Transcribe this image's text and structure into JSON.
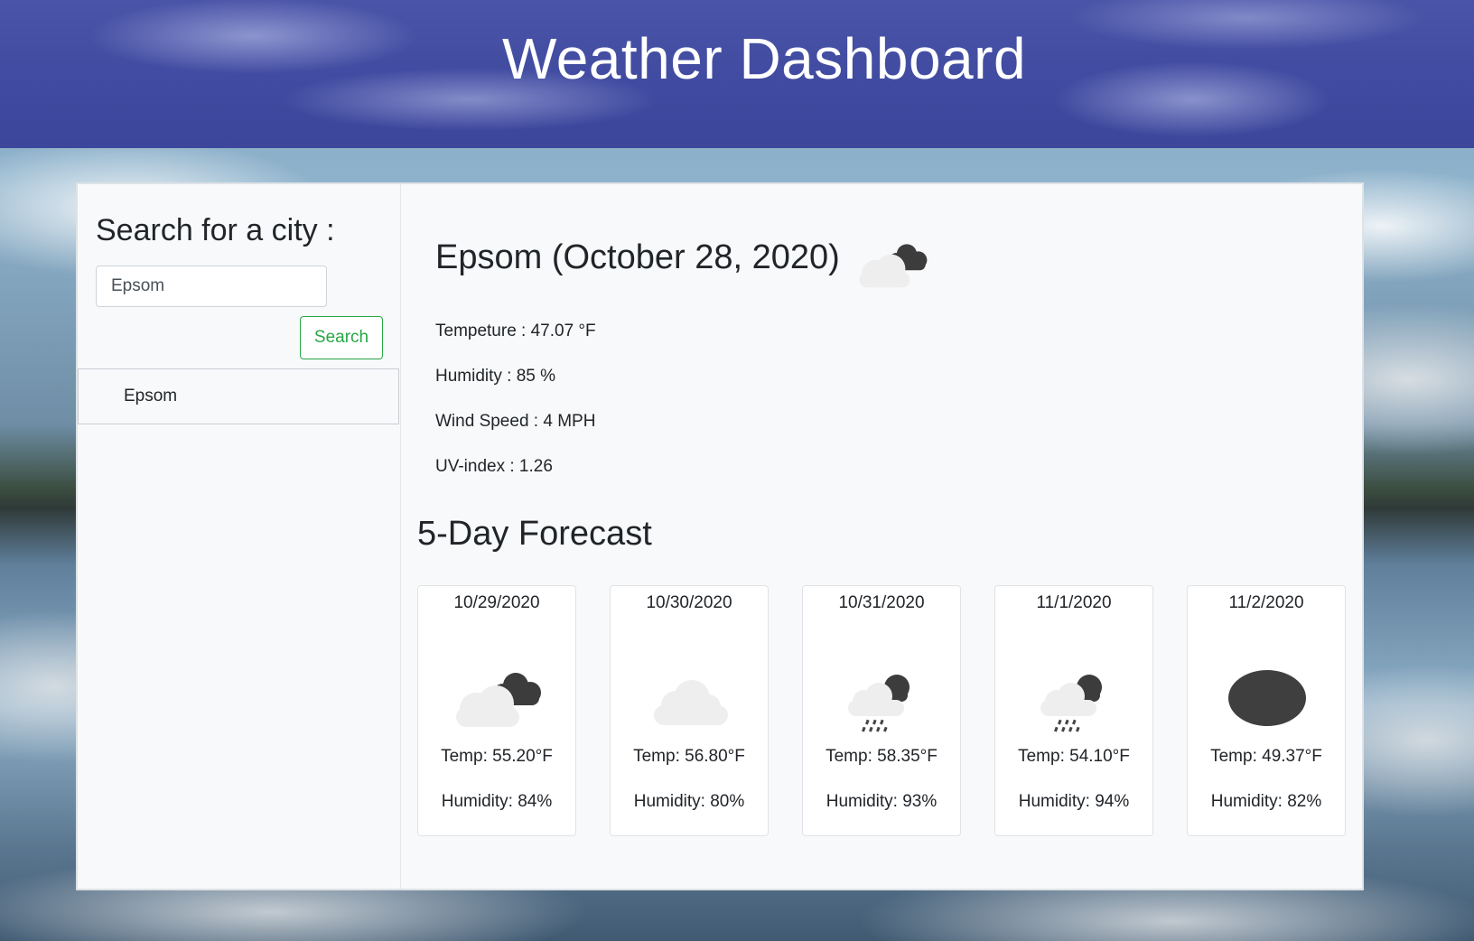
{
  "header": {
    "title": "Weather Dashboard"
  },
  "sidebar": {
    "heading": "Search for a city :",
    "search_value": "Epsom",
    "search_button": "Search",
    "history": [
      "Epsom"
    ]
  },
  "current": {
    "title": "Epsom (October 28, 2020)",
    "icon": "broken-clouds-icon",
    "temperature": "Tempeture : 47.07 °F",
    "humidity": "Humidity : 85 %",
    "wind": "Wind Speed : 4 MPH",
    "uv": "UV-index : 1.26"
  },
  "forecast": {
    "title": "5-Day Forecast",
    "days": [
      {
        "date": "10/29/2020",
        "icon": "broken-clouds-icon",
        "temp": "Temp: 55.20°F",
        "humidity": "Humidity: 84%"
      },
      {
        "date": "10/30/2020",
        "icon": "cloud-icon",
        "temp": "Temp: 56.80°F",
        "humidity": "Humidity: 80%"
      },
      {
        "date": "10/31/2020",
        "icon": "rain-icon",
        "temp": "Temp: 58.35°F",
        "humidity": "Humidity: 93%"
      },
      {
        "date": "11/1/2020",
        "icon": "rain-icon",
        "temp": "Temp: 54.10°F",
        "humidity": "Humidity: 94%"
      },
      {
        "date": "11/2/2020",
        "icon": "dark-cloud-icon",
        "temp": "Temp: 49.37°F",
        "humidity": "Humidity: 82%"
      }
    ]
  }
}
